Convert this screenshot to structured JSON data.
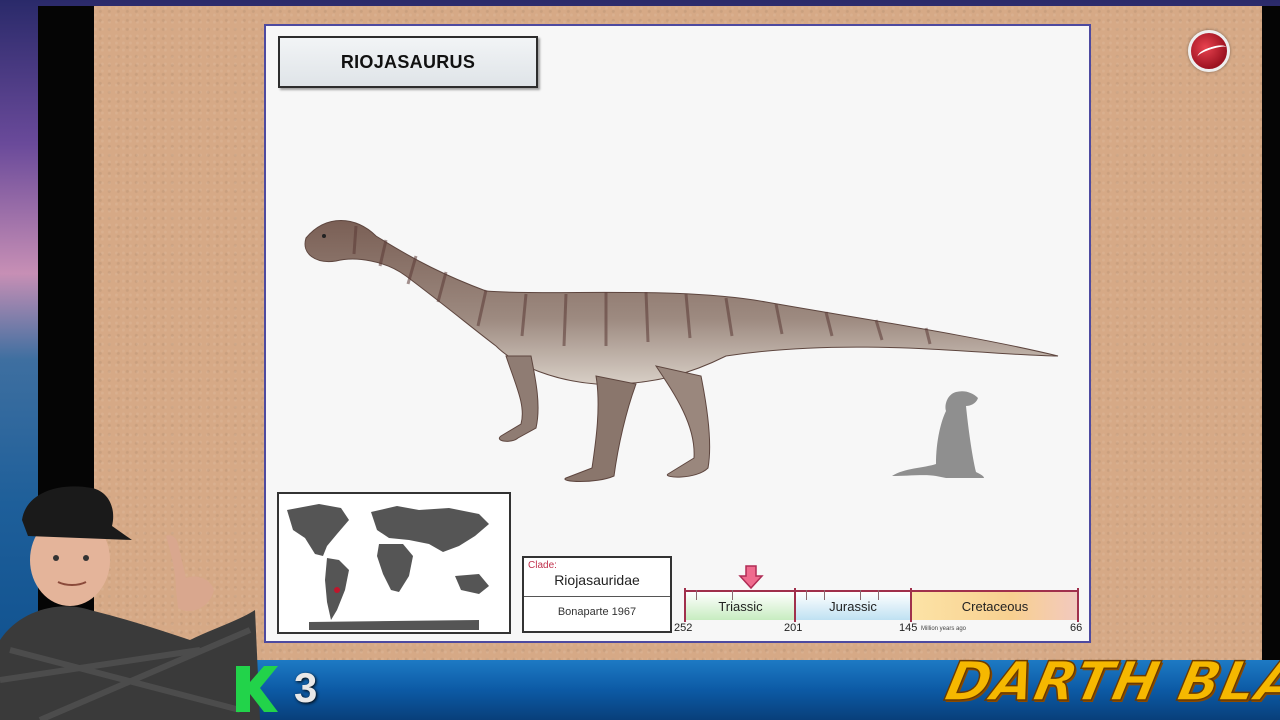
{
  "slide": {
    "title": "RIOJASAURUS",
    "clade": {
      "label": "Clade:",
      "name": "Riojasauridae",
      "author": "Bonaparte 1967"
    },
    "timeline": {
      "periods": [
        "Triassic",
        "Jurassic",
        "Cretaceous"
      ],
      "ticks": [
        "252",
        "201",
        "145",
        "66"
      ],
      "unit_label": "Million years ago"
    }
  },
  "overlay": {
    "k_count": "3",
    "brand": "DARTH BLAZE"
  },
  "colors": {
    "accent_brand": "#f6b800",
    "slide_border": "#4d4aa0",
    "timeline_line": "#a0304c",
    "k_logo": "#22d34a"
  },
  "icons": [
    "channel-logo-icon",
    "k-logo-icon",
    "timeline-arrow-icon"
  ]
}
